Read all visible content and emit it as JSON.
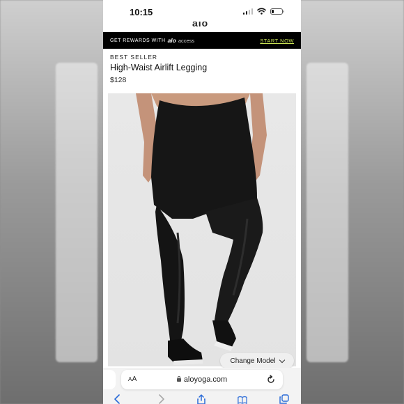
{
  "status_bar": {
    "time": "10:15",
    "signal_bars": 4,
    "signal_bars_active": 2,
    "battery_level": 0.2
  },
  "header": {
    "logo_partial": "alo"
  },
  "promo": {
    "text": "GET REWARDS WITH",
    "brand": "alo",
    "brand_suffix": "access",
    "cta": "START NOW",
    "cta_color": "#c9e255"
  },
  "product": {
    "badge": "BEST SELLER",
    "title": "High-Waist Airlift Legging",
    "price": "$128",
    "image_alt": "model wearing black legging, back view"
  },
  "change_model": {
    "label": "Change Model",
    "icon": "chevron-down-icon"
  },
  "browser": {
    "text_size_label_small": "A",
    "text_size_label_large": "A",
    "url": "aloyoga.com",
    "lock_icon": "lock-icon",
    "reload_icon": "reload-icon"
  },
  "toolbar": {
    "icons": [
      "back-icon",
      "forward-icon",
      "share-icon",
      "bookmarks-icon",
      "tabs-icon"
    ]
  }
}
